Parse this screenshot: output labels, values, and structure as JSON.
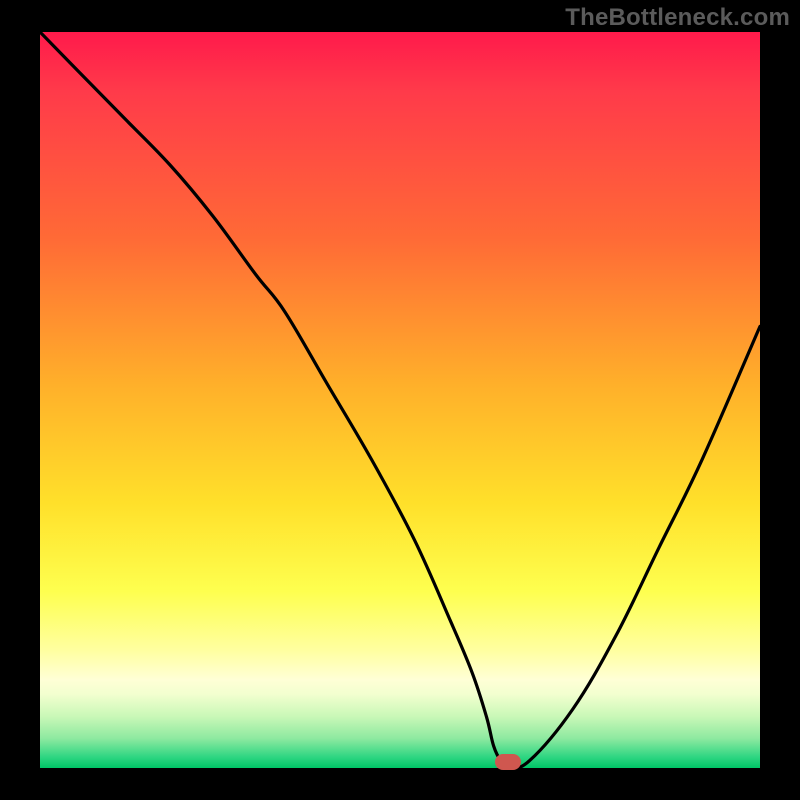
{
  "watermark": "TheBottleneck.com",
  "colors": {
    "top": "#ff1a4b",
    "mid_upper": "#ff7a2e",
    "mid": "#ffd92e",
    "mid_lower": "#ffff8a",
    "lower": "#f3ffd0",
    "green_mid": "#7de88f",
    "green_base": "#00cf6d",
    "curve": "#000000",
    "marker": "#cf574f",
    "background": "#000000"
  },
  "chart_data": {
    "type": "line",
    "title": "",
    "xlabel": "",
    "ylabel": "",
    "xlim": [
      0,
      100
    ],
    "ylim": [
      0,
      100
    ],
    "grid": false,
    "legend": false,
    "series": [
      {
        "name": "bottleneck-curve",
        "x": [
          0,
          6,
          12,
          18,
          24,
          30,
          34,
          40,
          46,
          52,
          57,
          60,
          62,
          63,
          64,
          65,
          68,
          74,
          80,
          86,
          92,
          100
        ],
        "y": [
          100,
          94,
          88,
          82,
          75,
          67,
          62,
          52,
          42,
          31,
          20,
          13,
          7,
          3,
          1,
          0,
          1,
          8,
          18,
          30,
          42,
          60
        ]
      }
    ],
    "marker": {
      "x": 65,
      "y": 0.8,
      "shape": "pill"
    },
    "green_band": {
      "y0": 0,
      "y1": 2.5
    },
    "pale_band": {
      "y0": 2.5,
      "y1": 12
    }
  }
}
